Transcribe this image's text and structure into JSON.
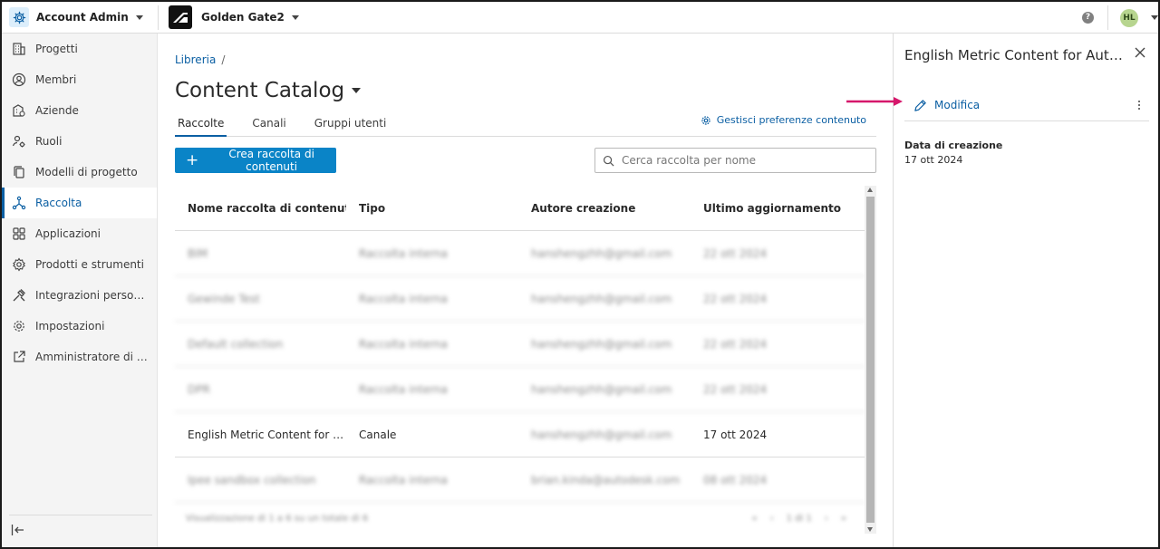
{
  "topbar": {
    "account_label": "Account Admin",
    "project_label": "Golden Gate2",
    "help_label": "?",
    "avatar_initials": "HL"
  },
  "sidebar": {
    "items": [
      {
        "label": "Progetti",
        "icon": "building-icon"
      },
      {
        "label": "Membri",
        "icon": "user-circle-icon"
      },
      {
        "label": "Aziende",
        "icon": "company-icon"
      },
      {
        "label": "Ruoli",
        "icon": "user-gear-icon"
      },
      {
        "label": "Modelli di progetto",
        "icon": "copy-icon"
      },
      {
        "label": "Raccolta",
        "icon": "network-icon"
      },
      {
        "label": "Applicazioni",
        "icon": "grid-icon"
      },
      {
        "label": "Prodotti e strumenti",
        "icon": "cog-box-icon"
      },
      {
        "label": "Integrazioni personali...",
        "icon": "tools-icon"
      },
      {
        "label": "Impostazioni",
        "icon": "gear-icon"
      },
      {
        "label": "Amministratore di BIM...",
        "icon": "external-link-icon"
      }
    ],
    "active_index": 5
  },
  "main": {
    "breadcrumb_link": "Libreria",
    "breadcrumb_sep": "/",
    "page_title": "Content Catalog",
    "tabs": [
      "Raccolte",
      "Canali",
      "Gruppi utenti"
    ],
    "active_tab": 0,
    "pref_link": "Gestisci preferenze contenuto",
    "create_button": "Crea raccolta di contenuti",
    "search_placeholder": "Cerca raccolta per nome",
    "table": {
      "headers": [
        "Nome raccolta di contenuti",
        "Tipo",
        "Autore creazione",
        "Ultimo aggiornamento"
      ],
      "rows": [
        {
          "name": "BIM",
          "type": "Raccolta interna",
          "author": "hanshengzhh@gmail.com",
          "date": "22 ott 2024",
          "blurred": true
        },
        {
          "name": "Gewinde Test",
          "type": "Raccolta interna",
          "author": "hanshengzhh@gmail.com",
          "date": "22 ott 2024",
          "blurred": true
        },
        {
          "name": "Default collection",
          "type": "Raccolta interna",
          "author": "hanshengzhh@gmail.com",
          "date": "22 ott 2024",
          "blurred": true
        },
        {
          "name": "DPR",
          "type": "Raccolta interna",
          "author": "hanshengzhh@gmail.com",
          "date": "22 ott 2024",
          "blurred": true
        },
        {
          "name": "English Metric Content for Aut...",
          "type": "Canale",
          "author": "hanshengzhh@gmail.com",
          "date": "17 ott 2024",
          "blurred": false
        },
        {
          "name": "Ipee sandbox collection",
          "type": "Raccolta interna",
          "author": "brian.kinda@autodesk.com",
          "date": "08 ott 2024",
          "blurred": true
        }
      ],
      "footer_text": "Visualizzazione di 1 a 6 su un totale di 6",
      "pager": [
        "«",
        "‹",
        "1 di 1",
        "›",
        "»"
      ]
    }
  },
  "panel": {
    "title": "English Metric Content for Autodesk",
    "edit_label": "Modifica",
    "date_label": "Data di creazione",
    "date_value": "17 ott 2024"
  },
  "colors": {
    "accent": "#0b5fa3",
    "button": "#0a84c7",
    "annotation_arrow": "#d6176b"
  }
}
